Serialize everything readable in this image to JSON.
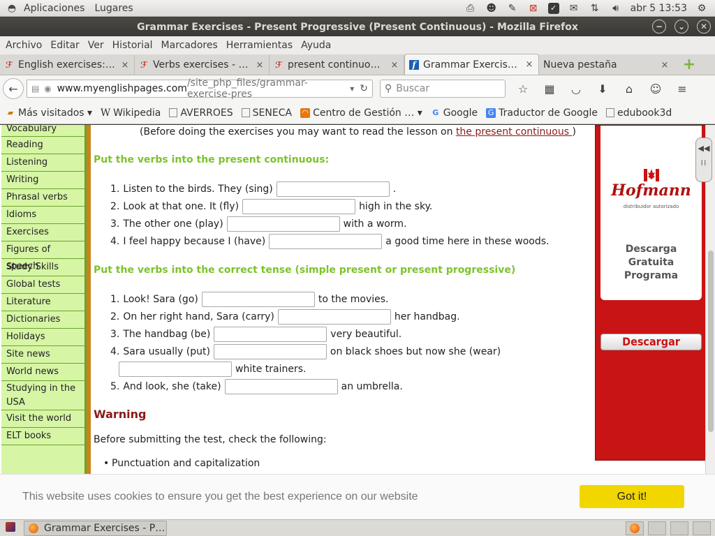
{
  "top_panel": {
    "apps_label": "Aplicaciones",
    "places_label": "Lugares",
    "clock": "abr 5 13:53"
  },
  "window": {
    "title": "Grammar Exercises - Present Progressive (Present Continuous) - Mozilla Firefox"
  },
  "menubar": {
    "items": [
      "Archivo",
      "Editar",
      "Ver",
      "Historial",
      "Marcadores",
      "Herramientas",
      "Ayuda"
    ]
  },
  "tabs": [
    {
      "label": "English exercises:…",
      "close": "×"
    },
    {
      "label": "Verbs exercises - …",
      "close": "×"
    },
    {
      "label": "present continuo…",
      "close": "×"
    },
    {
      "label": "Grammar Exercis…",
      "close": "×"
    },
    {
      "label": "Nueva pestaña",
      "close": "×"
    }
  ],
  "navbar": {
    "url_host": "www.myenglishpages.com",
    "url_path": "/site_php_files/grammar-exercise-pres",
    "search_placeholder": "Buscar"
  },
  "bookmarks": [
    {
      "label": "Más visitados ▾",
      "icon": "folder-icon"
    },
    {
      "label": "Wikipedia",
      "icon": "wikipedia-icon"
    },
    {
      "label": "AVERROES",
      "icon": "page-icon"
    },
    {
      "label": "SENECA",
      "icon": "page-icon"
    },
    {
      "label": "Centro de Gestión … ▾",
      "icon": "rss-icon"
    },
    {
      "label": "Google",
      "icon": "google-icon"
    },
    {
      "label": "Traductor de Google",
      "icon": "translate-icon"
    },
    {
      "label": "edubook3d",
      "icon": "page-icon"
    }
  ],
  "left_nav": [
    "Vocabulary",
    "Reading",
    "Listening",
    "Writing",
    "Phrasal verbs",
    "Idioms",
    "Exercises",
    "Figures of speech",
    "Study Skills",
    "Global tests",
    "Literature",
    "Dictionaries",
    "Holidays",
    "Site news",
    "World news",
    "Studying in the USA",
    "Visit the world",
    "ELT books"
  ],
  "content": {
    "intro_before": "(Before doing the exercises you may want to read the lesson on ",
    "intro_link": "the present continuous ",
    "intro_after": ")",
    "section1_title": "Put the verbs into the present continuous:",
    "section1": [
      {
        "num": "1.",
        "before": "Listen to the birds. They (sing)",
        "after": "."
      },
      {
        "num": "2.",
        "before": "Look at that one. It (fly)",
        "after": "high in the sky."
      },
      {
        "num": "3.",
        "before": "The other one (play)",
        "after": "with a worm."
      },
      {
        "num": "4.",
        "before": "I feel happy because I (have)",
        "after": "a good time here in these woods."
      }
    ],
    "section2_title": "Put the verbs into the correct tense (simple present or present progressive)",
    "section2": [
      {
        "num": "1.",
        "before": "Look! Sara (go)",
        "after": "to the movies."
      },
      {
        "num": "2.",
        "before": "On her right hand, Sara (carry)",
        "after": "her handbag."
      },
      {
        "num": "3.",
        "before": "The handbag (be)",
        "after": "very beautiful."
      },
      {
        "num": "4.",
        "before": "Sara usually (put)",
        "after": "on black shoes but now she (wear)"
      },
      {
        "num": "",
        "before": "",
        "after": "white trainers."
      },
      {
        "num": "5.",
        "before": "And look, she (take)",
        "after": "an umbrella."
      }
    ],
    "warning_title": "Warning",
    "warning_text": "Before submitting the test, check the following:",
    "bullet": "Punctuation and capitalization"
  },
  "ad": {
    "logo": "Hofmann",
    "logo_sub": "distribuidor autorizado",
    "line1": "Descarga",
    "line2": "Gratuita",
    "line3": "Programa",
    "button": "Descargar"
  },
  "cookie": {
    "text": "This website uses cookies to ensure you get the best experience on our website",
    "button": "Got it!"
  },
  "taskbar": {
    "item": "Grammar Exercises - P…"
  }
}
